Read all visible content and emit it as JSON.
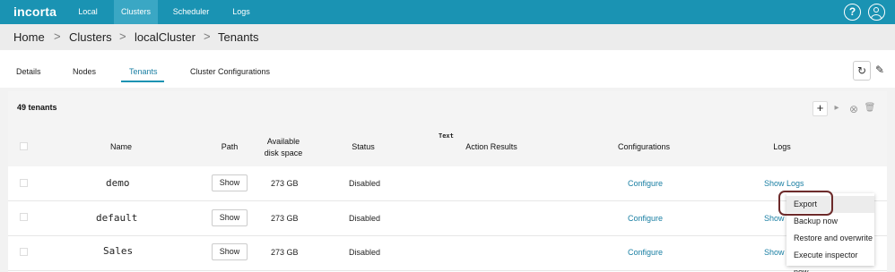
{
  "app": {
    "logo": "incorta"
  },
  "nav": {
    "local": "Local",
    "clusters": "Clusters",
    "scheduler": "Scheduler",
    "logs": "Logs",
    "help_icon": "?"
  },
  "breadcrumb": {
    "home": "Home",
    "clusters": "Clusters",
    "cluster": "localCluster",
    "tenants": "Tenants",
    "separator": ">"
  },
  "tabs": {
    "details": "Details",
    "nodes": "Nodes",
    "tenants": "Tenants",
    "cluster_configurations": "Cluster Configurations"
  },
  "actions": {
    "refresh_icon": "↻",
    "edit_icon": "✎"
  },
  "panel": {
    "count": "49 tenants",
    "toolbar": {
      "add": "+",
      "start": "▸",
      "stop": "⊗",
      "delete": "🗑"
    }
  },
  "table": {
    "text_tag": "Text",
    "headers": {
      "name": "Name",
      "path": "Path",
      "disk_line1": "Available",
      "disk_line2": "disk space",
      "status": "Status",
      "action_results": "Action Results",
      "configurations": "Configurations",
      "logs": "Logs"
    },
    "rows": [
      {
        "name": "demo",
        "path_btn": "Show",
        "disk": "273 GB",
        "status": "Disabled",
        "configure": "Configure",
        "logs": "Show Logs"
      },
      {
        "name": "default",
        "path_btn": "Show",
        "disk": "273 GB",
        "status": "Disabled",
        "configure": "Configure",
        "logs": "Show L"
      },
      {
        "name": "Sales",
        "path_btn": "Show",
        "disk": "273 GB",
        "status": "Disabled",
        "configure": "Configure",
        "logs": "Show L"
      }
    ]
  },
  "menu": {
    "export": "Export",
    "backup": "Backup now",
    "restore": "Restore and overwrite",
    "inspector": "Execute inspector now"
  },
  "colors": {
    "topbar": "#1a93b3",
    "link": "#1a7fa3",
    "highlight": "#6d2b2b"
  }
}
